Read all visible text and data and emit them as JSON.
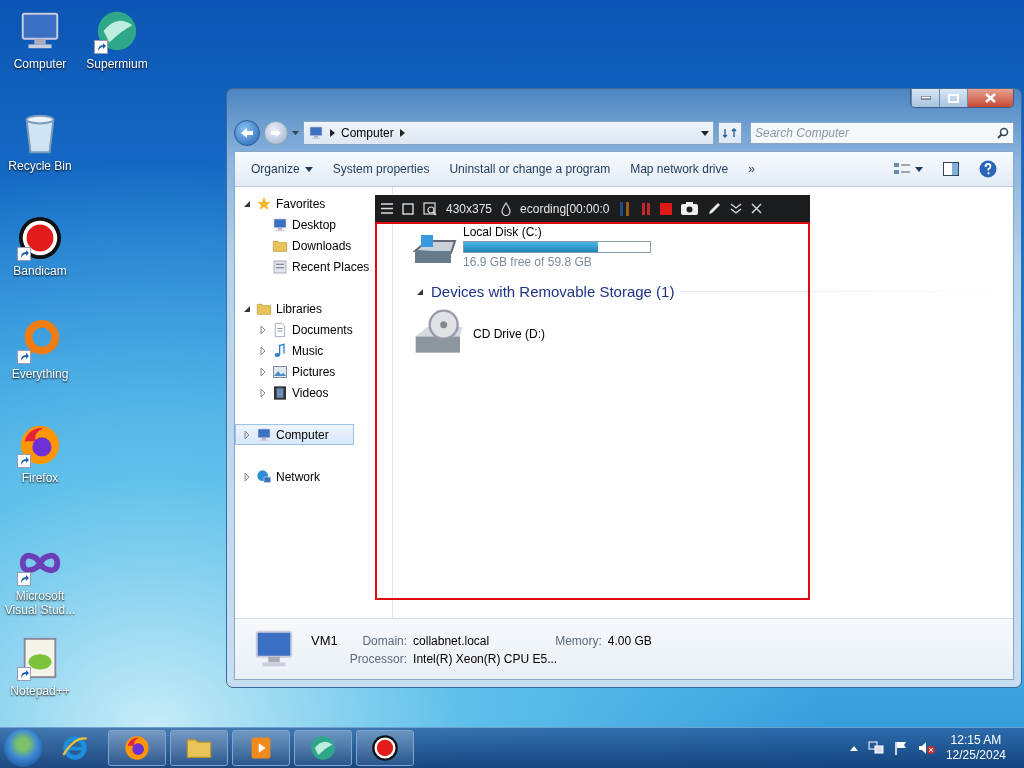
{
  "desktop_icons": [
    {
      "label": "Computer",
      "kind": "computer",
      "shortcut": false
    },
    {
      "label": "Supermium",
      "kind": "globe",
      "shortcut": true
    },
    {
      "label": "Recycle Bin",
      "kind": "bin",
      "shortcut": false
    },
    {
      "label": "Bandicam",
      "kind": "record",
      "shortcut": true
    },
    {
      "label": "Everything",
      "kind": "ring",
      "shortcut": true
    },
    {
      "label": "Firefox",
      "kind": "firefox",
      "shortcut": true
    },
    {
      "label": "Microsoft Visual Stud...",
      "kind": "infinity",
      "shortcut": true
    },
    {
      "label": "Notepad++",
      "kind": "notepad",
      "shortcut": true
    }
  ],
  "window": {
    "address": {
      "path": [
        "Computer"
      ]
    },
    "search": {
      "placeholder": "Search Computer"
    },
    "toolbar": [
      {
        "label": "Organize",
        "dropdown": true
      },
      {
        "label": "System properties",
        "dropdown": false
      },
      {
        "label": "Uninstall or change a program",
        "dropdown": false
      },
      {
        "label": "Map network drive",
        "dropdown": false
      },
      {
        "label": "»",
        "dropdown": false
      }
    ],
    "nav_tree": [
      {
        "label": "Favorites",
        "kind": "star",
        "expanded": true,
        "selected": false,
        "children": [
          {
            "label": "Desktop",
            "kind": "desktop",
            "selected": false
          },
          {
            "label": "Downloads",
            "kind": "folder",
            "selected": false
          },
          {
            "label": "Recent Places",
            "kind": "recent",
            "selected": false
          }
        ]
      },
      {
        "label": "Libraries",
        "kind": "library",
        "expanded": true,
        "selected": false,
        "children": [
          {
            "label": "Documents",
            "kind": "document",
            "expanded": false,
            "selected": false
          },
          {
            "label": "Music",
            "kind": "music",
            "expanded": false,
            "selected": false
          },
          {
            "label": "Pictures",
            "kind": "picture",
            "expanded": false,
            "selected": false
          },
          {
            "label": "Videos",
            "kind": "video",
            "expanded": false,
            "selected": false
          }
        ]
      },
      {
        "label": "Computer",
        "kind": "computer",
        "expanded": false,
        "selected": true
      },
      {
        "label": "Network",
        "kind": "network",
        "expanded": false,
        "selected": false
      }
    ],
    "hard_disks": [
      {
        "name": "Local Disk (C:)",
        "level": 0.72,
        "free_space": "16.9 GB free of 59.8 GB"
      }
    ],
    "groups": [
      {
        "title": "Devices with Removable Storage (1)",
        "expanded": true,
        "items": [
          {
            "name": "CD Drive (D:)",
            "kind": "cd"
          }
        ]
      }
    ],
    "details": {
      "name": "VM1",
      "fields": [
        {
          "label": "Domain:",
          "value": "collabnet.local"
        },
        {
          "label": "Memory:",
          "value": "4.00 GB"
        },
        {
          "label": "Processor:",
          "value": "Intel(R) Xeon(R) CPU E5..."
        }
      ]
    }
  },
  "recorder": {
    "size": "430x375",
    "status": "ecording[00:00:0"
  },
  "taskbar": {
    "items": [
      {
        "kind": "ie",
        "running": false
      },
      {
        "kind": "firefox",
        "running": true
      },
      {
        "kind": "folder",
        "running": true
      },
      {
        "kind": "media",
        "running": true
      },
      {
        "kind": "globe",
        "running": true
      },
      {
        "kind": "record",
        "running": true
      }
    ],
    "time": "12:15 AM",
    "date": "12/25/2024"
  }
}
